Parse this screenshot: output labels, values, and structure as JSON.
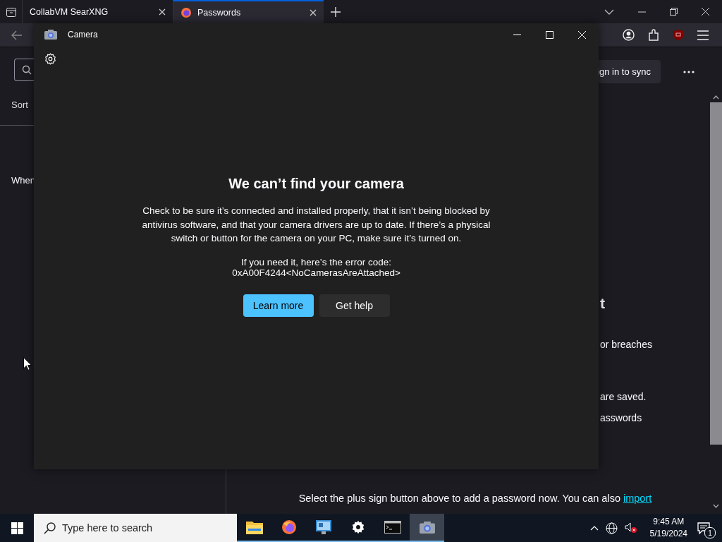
{
  "browser": {
    "tabs": [
      {
        "title": "CollabVM SearXNG",
        "selected": false,
        "favicon": false
      },
      {
        "title": "Passwords",
        "selected": true,
        "favicon": true
      }
    ]
  },
  "sidebar": {
    "sort_label": "Sort",
    "empty_text": "When"
  },
  "main": {
    "sync_button": "ign in to sync",
    "heading": "t",
    "lines": [
      "or breaches",
      "are saved.",
      "asswords"
    ],
    "footer_text": "Select the plus sign button above to add a password now. You can also",
    "import_link": "import"
  },
  "camera": {
    "title": "Camera",
    "heading": "We can’t find your camera",
    "message": "Check to be sure it’s connected and installed properly, that it isn’t being blocked by antivirus software, and that your camera drivers are up to date. If there’s a physical switch or button for the camera on your PC, make sure it’s turned on.",
    "error_intro": "If you need it, here’s the error code:",
    "error_code": "0xA00F4244<NoCamerasAreAttached>",
    "buttons": [
      {
        "label": "Learn more",
        "kind": "primary"
      },
      {
        "label": "Get help",
        "kind": "secondary"
      }
    ]
  },
  "taskbar": {
    "search_placeholder": "Type here to search",
    "apps": [
      {
        "kind": "files",
        "active": false
      },
      {
        "kind": "firefox",
        "active": false
      },
      {
        "kind": "monitor",
        "active": false
      },
      {
        "kind": "settings",
        "active": false
      },
      {
        "kind": "terminal",
        "active": false
      },
      {
        "kind": "camera",
        "active": true
      }
    ],
    "time": "9:45 AM",
    "date": "5/19/2024",
    "notification_count": "1"
  }
}
